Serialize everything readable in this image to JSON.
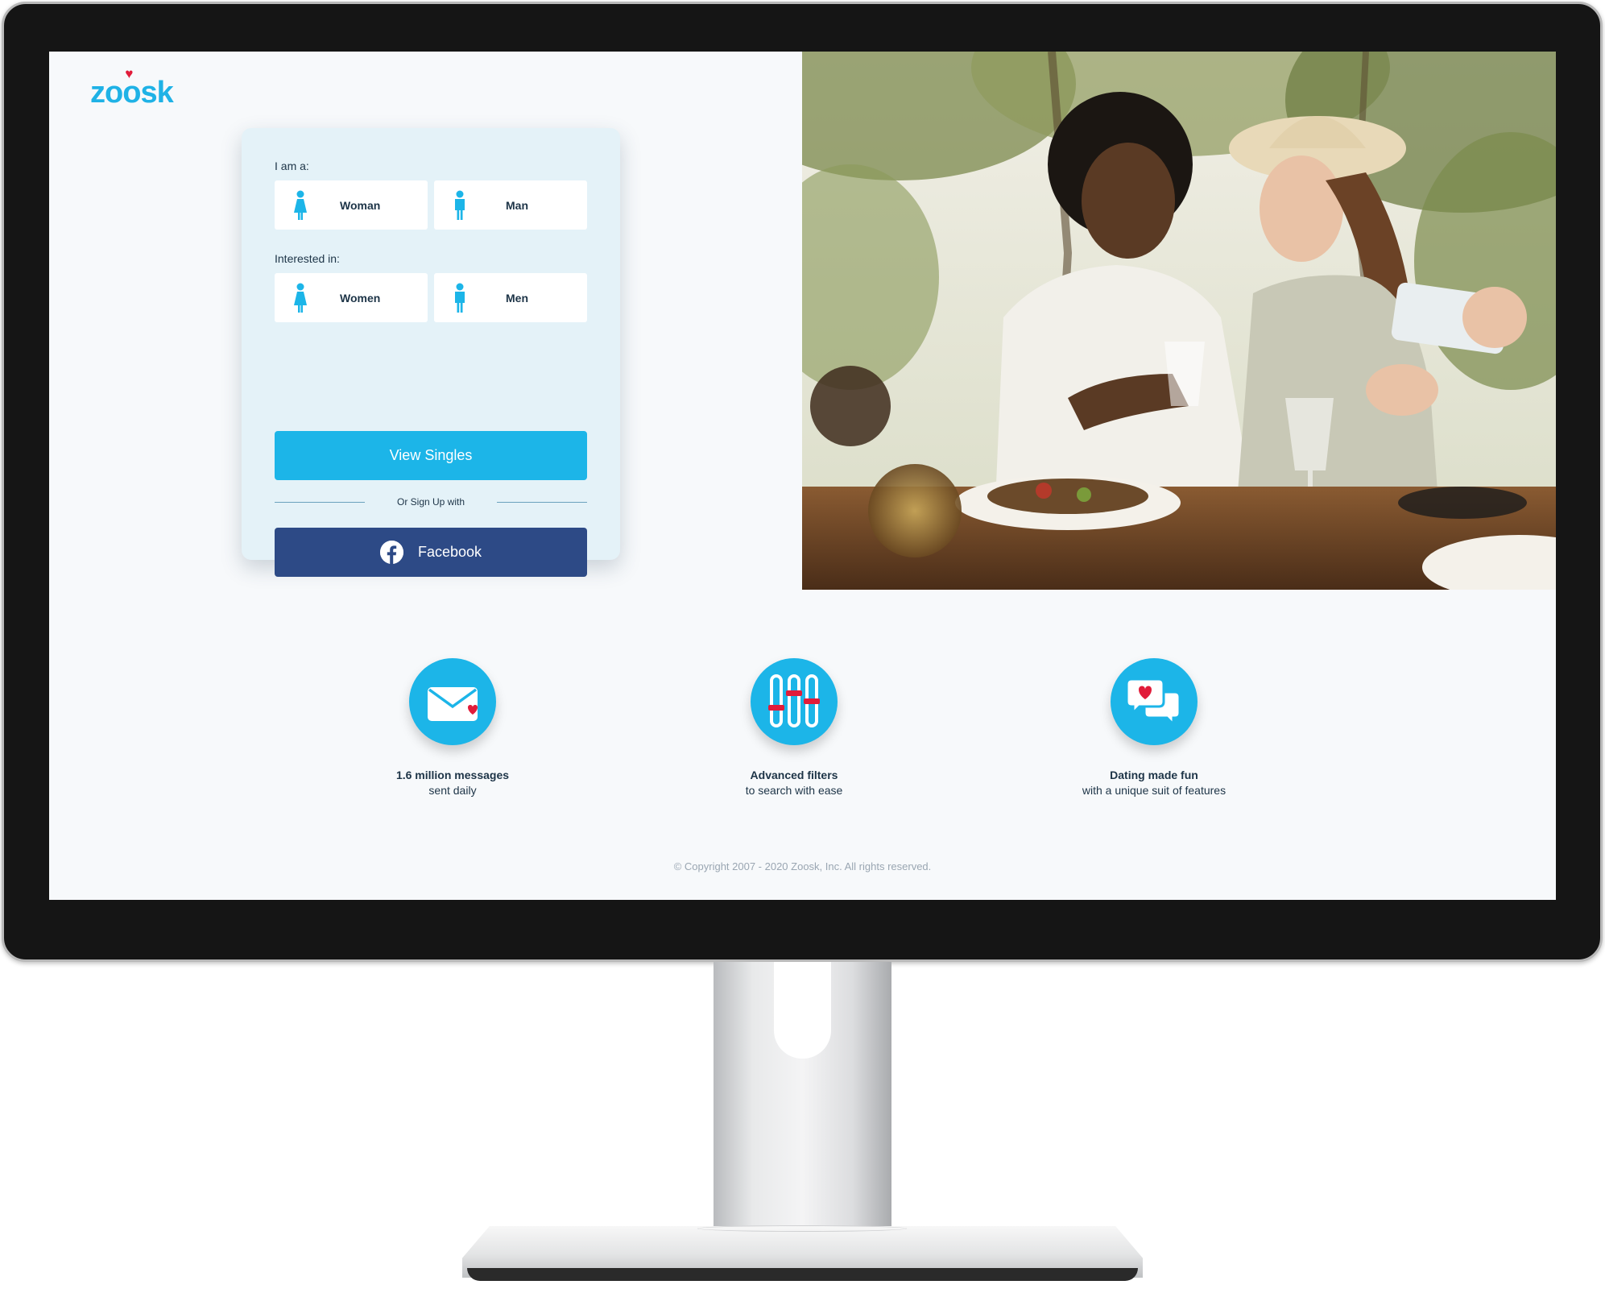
{
  "brand": {
    "logo_text_pre": "zo",
    "logo_text_o": "o",
    "logo_text_post": "sk",
    "accent": "#1cb5e8",
    "heart_color": "#e11c3a",
    "facebook_color": "#2d4a86"
  },
  "form": {
    "i_am_label": "I am a:",
    "i_am_options": [
      "Woman",
      "Man"
    ],
    "interested_label": "Interested in:",
    "interested_options": [
      "Women",
      "Men"
    ],
    "view_button": "View Singles",
    "divider_text": "Or Sign Up with",
    "facebook_button": "Facebook"
  },
  "features": [
    {
      "icon": "envelope-heart-icon",
      "title": "1.6 million messages",
      "subtitle": "sent daily"
    },
    {
      "icon": "sliders-filter-icon",
      "title": "Advanced filters",
      "subtitle": "to search with ease"
    },
    {
      "icon": "chat-heart-icon",
      "title": "Dating made fun",
      "subtitle": "with a unique suit of features"
    }
  ],
  "footer": {
    "copyright": "© Copyright 2007 - 2020 Zoosk, Inc. All rights reserved."
  }
}
